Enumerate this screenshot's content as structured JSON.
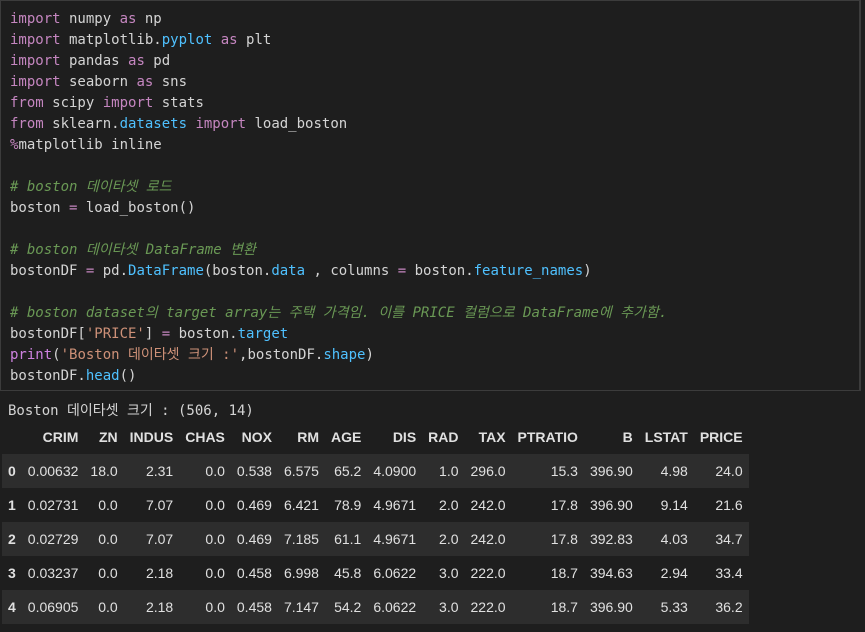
{
  "code_lines": [
    [
      {
        "t": "import",
        "c": "kw"
      },
      {
        "t": " numpy "
      },
      {
        "t": "as",
        "c": "kw"
      },
      {
        "t": " np"
      }
    ],
    [
      {
        "t": "import",
        "c": "kw"
      },
      {
        "t": " matplotlib."
      },
      {
        "t": "pyplot",
        "c": "attr"
      },
      {
        "t": " "
      },
      {
        "t": "as",
        "c": "kw"
      },
      {
        "t": " plt"
      }
    ],
    [
      {
        "t": "import",
        "c": "kw"
      },
      {
        "t": " pandas "
      },
      {
        "t": "as",
        "c": "kw"
      },
      {
        "t": " pd"
      }
    ],
    [
      {
        "t": "import",
        "c": "kw"
      },
      {
        "t": " seaborn "
      },
      {
        "t": "as",
        "c": "kw"
      },
      {
        "t": " sns"
      }
    ],
    [
      {
        "t": "from",
        "c": "kw"
      },
      {
        "t": " scipy "
      },
      {
        "t": "import",
        "c": "kw"
      },
      {
        "t": " stats"
      }
    ],
    [
      {
        "t": "from",
        "c": "kw"
      },
      {
        "t": " sklearn."
      },
      {
        "t": "datasets",
        "c": "attr"
      },
      {
        "t": " "
      },
      {
        "t": "import",
        "c": "kw"
      },
      {
        "t": " load_boston"
      }
    ],
    [
      {
        "t": "%",
        "c": "kw"
      },
      {
        "t": "matplotlib inline"
      }
    ],
    [],
    [
      {
        "t": "# boston 데이타셋 로드",
        "c": "cm"
      }
    ],
    [
      {
        "t": "boston "
      },
      {
        "t": "=",
        "c": "kw"
      },
      {
        "t": " load_boston()"
      }
    ],
    [],
    [
      {
        "t": "# boston 데이타셋 DataFrame 변환",
        "c": "cm"
      }
    ],
    [
      {
        "t": "bostonDF "
      },
      {
        "t": "=",
        "c": "kw"
      },
      {
        "t": " pd."
      },
      {
        "t": "DataFrame",
        "c": "attr"
      },
      {
        "t": "(boston."
      },
      {
        "t": "data",
        "c": "attr"
      },
      {
        "t": " , columns "
      },
      {
        "t": "=",
        "c": "kw"
      },
      {
        "t": " boston."
      },
      {
        "t": "feature_names",
        "c": "attr"
      },
      {
        "t": ")"
      }
    ],
    [],
    [
      {
        "t": "# boston dataset의 target array는 주택 가격임. 이를 PRICE 컬럼으로 DataFrame에 추가함.",
        "c": "cm"
      }
    ],
    [
      {
        "t": "bostonDF["
      },
      {
        "t": "'PRICE'",
        "c": "str"
      },
      {
        "t": "] "
      },
      {
        "t": "=",
        "c": "kw"
      },
      {
        "t": " boston."
      },
      {
        "t": "target",
        "c": "attr"
      }
    ],
    [
      {
        "t": "print",
        "c": "kwg"
      },
      {
        "t": "("
      },
      {
        "t": "'Boston 데이타셋 크기 :'",
        "c": "str"
      },
      {
        "t": ",bostonDF."
      },
      {
        "t": "shape",
        "c": "attr"
      },
      {
        "t": ")"
      }
    ],
    [
      {
        "t": "bostonDF."
      },
      {
        "t": "head",
        "c": "attr"
      },
      {
        "t": "()"
      }
    ]
  ],
  "output": {
    "print_text": "Boston 데이타셋 크기 : (506, 14)",
    "columns": [
      "",
      "CRIM",
      "ZN",
      "INDUS",
      "CHAS",
      "NOX",
      "RM",
      "AGE",
      "DIS",
      "RAD",
      "TAX",
      "PTRATIO",
      "B",
      "LSTAT",
      "PRICE"
    ],
    "rows": [
      [
        "0",
        "0.00632",
        "18.0",
        "2.31",
        "0.0",
        "0.538",
        "6.575",
        "65.2",
        "4.0900",
        "1.0",
        "296.0",
        "15.3",
        "396.90",
        "4.98",
        "24.0"
      ],
      [
        "1",
        "0.02731",
        "0.0",
        "7.07",
        "0.0",
        "0.469",
        "6.421",
        "78.9",
        "4.9671",
        "2.0",
        "242.0",
        "17.8",
        "396.90",
        "9.14",
        "21.6"
      ],
      [
        "2",
        "0.02729",
        "0.0",
        "7.07",
        "0.0",
        "0.469",
        "7.185",
        "61.1",
        "4.9671",
        "2.0",
        "242.0",
        "17.8",
        "392.83",
        "4.03",
        "34.7"
      ],
      [
        "3",
        "0.03237",
        "0.0",
        "2.18",
        "0.0",
        "0.458",
        "6.998",
        "45.8",
        "6.0622",
        "3.0",
        "222.0",
        "18.7",
        "394.63",
        "2.94",
        "33.4"
      ],
      [
        "4",
        "0.06905",
        "0.0",
        "2.18",
        "0.0",
        "0.458",
        "7.147",
        "54.2",
        "6.0622",
        "3.0",
        "222.0",
        "18.7",
        "396.90",
        "5.33",
        "36.2"
      ]
    ]
  }
}
